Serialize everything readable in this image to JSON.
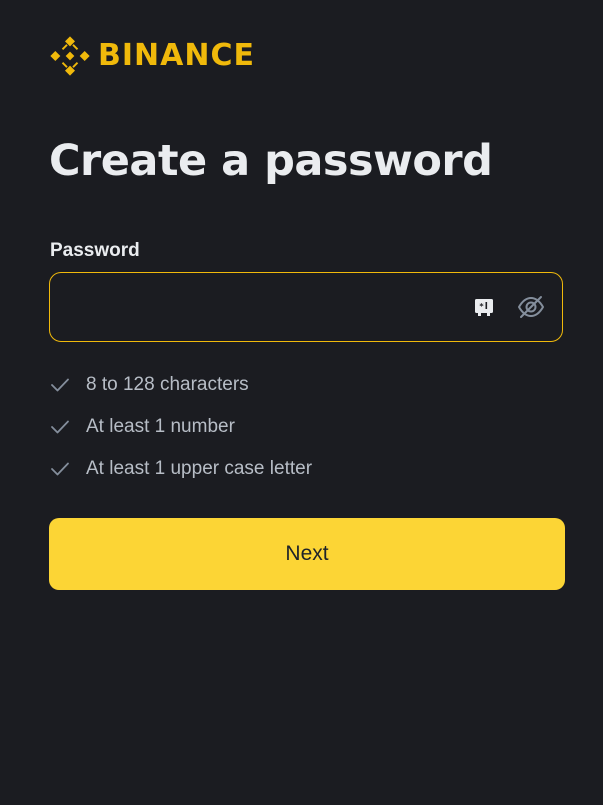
{
  "brand": {
    "name": "BINANCE",
    "logo_icon": "binance-diamond-logo-icon",
    "accent_color": "#f0b90b"
  },
  "page": {
    "title": "Create a password"
  },
  "password_field": {
    "label": "Password",
    "value": "",
    "placeholder": "",
    "password_manager_icon": "password-manager-icon",
    "visibility_icon": "eye-slash-icon",
    "border_color": "#f0b90b"
  },
  "requirements": [
    {
      "text": "8 to 128 characters",
      "met": false,
      "icon": "check-icon"
    },
    {
      "text": "At least 1 number",
      "met": false,
      "icon": "check-icon"
    },
    {
      "text": "At least 1 upper case letter",
      "met": false,
      "icon": "check-icon"
    }
  ],
  "actions": {
    "next_label": "Next",
    "next_color": "#fcd535"
  }
}
